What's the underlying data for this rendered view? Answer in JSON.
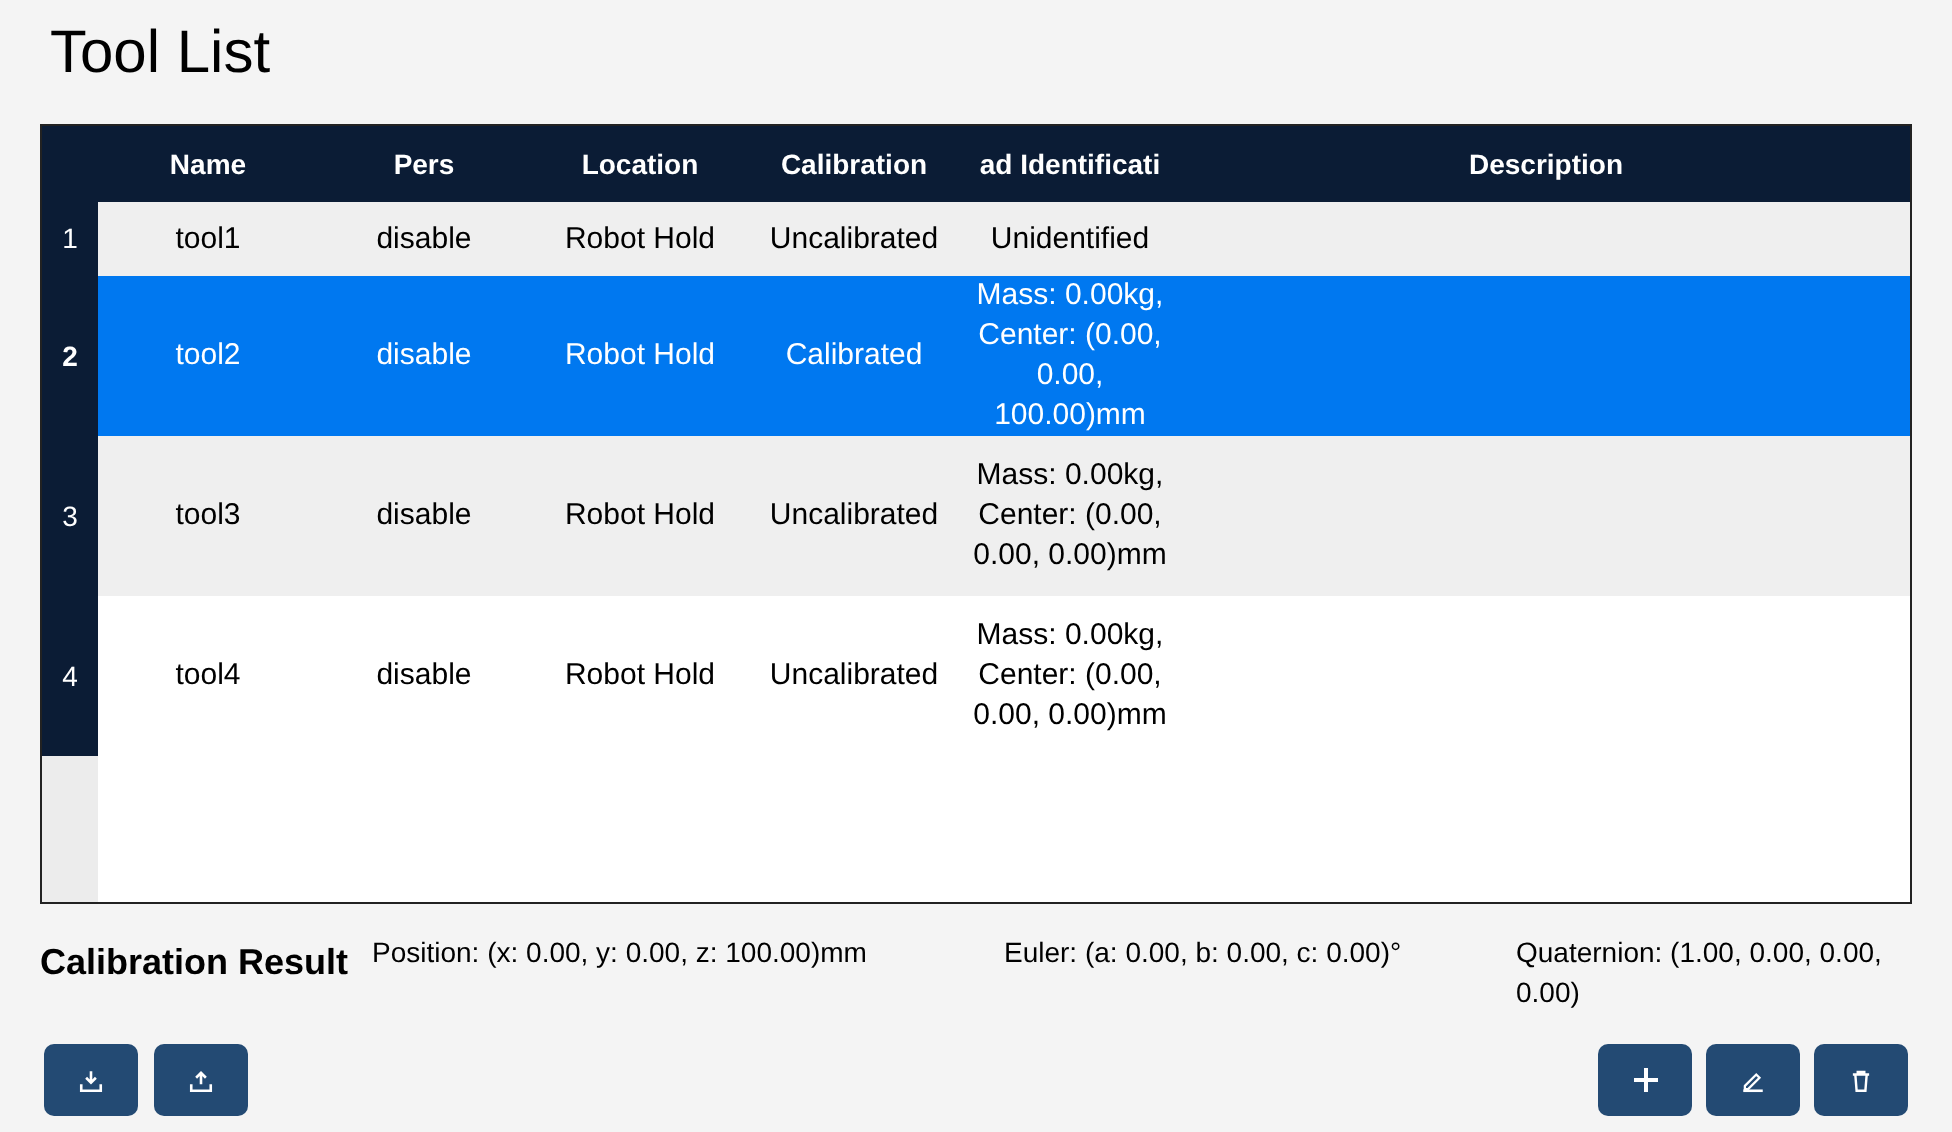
{
  "title": "Tool List",
  "table": {
    "columns": [
      "Name",
      "Pers",
      "Location",
      "Calibration",
      "ad Identificati",
      "Description"
    ],
    "rows": [
      {
        "index": "1",
        "selected": false,
        "cells": [
          "tool1",
          "disable",
          "Robot Hold",
          "Uncalibrated",
          "Unidentified",
          ""
        ]
      },
      {
        "index": "2",
        "selected": true,
        "cells": [
          "tool2",
          "disable",
          "Robot Hold",
          "Calibrated",
          "Mass: 0.00kg, Center: (0.00, 0.00, 100.00)mm",
          ""
        ]
      },
      {
        "index": "3",
        "selected": false,
        "cells": [
          "tool3",
          "disable",
          "Robot Hold",
          "Uncalibrated",
          "Mass: 0.00kg, Center: (0.00, 0.00, 0.00)mm",
          ""
        ]
      },
      {
        "index": "4",
        "selected": false,
        "cells": [
          "tool4",
          "disable",
          "Robot Hold",
          "Uncalibrated",
          "Mass: 0.00kg, Center: (0.00, 0.00, 0.00)mm",
          ""
        ]
      }
    ]
  },
  "calibration_result": {
    "label": "Calibration Result",
    "position": "Position: (x: 0.00, y: 0.00, z: 100.00)mm",
    "euler": "Euler: (a: 0.00, b: 0.00, c: 0.00)°",
    "quaternion": "Quaternion: (1.00, 0.00, 0.00, 0.00)"
  },
  "left_buttons": [
    {
      "kind": "import"
    },
    {
      "kind": "export"
    }
  ],
  "right_buttons": [
    {
      "kind": "add"
    },
    {
      "kind": "edit"
    },
    {
      "kind": "delete"
    }
  ]
}
